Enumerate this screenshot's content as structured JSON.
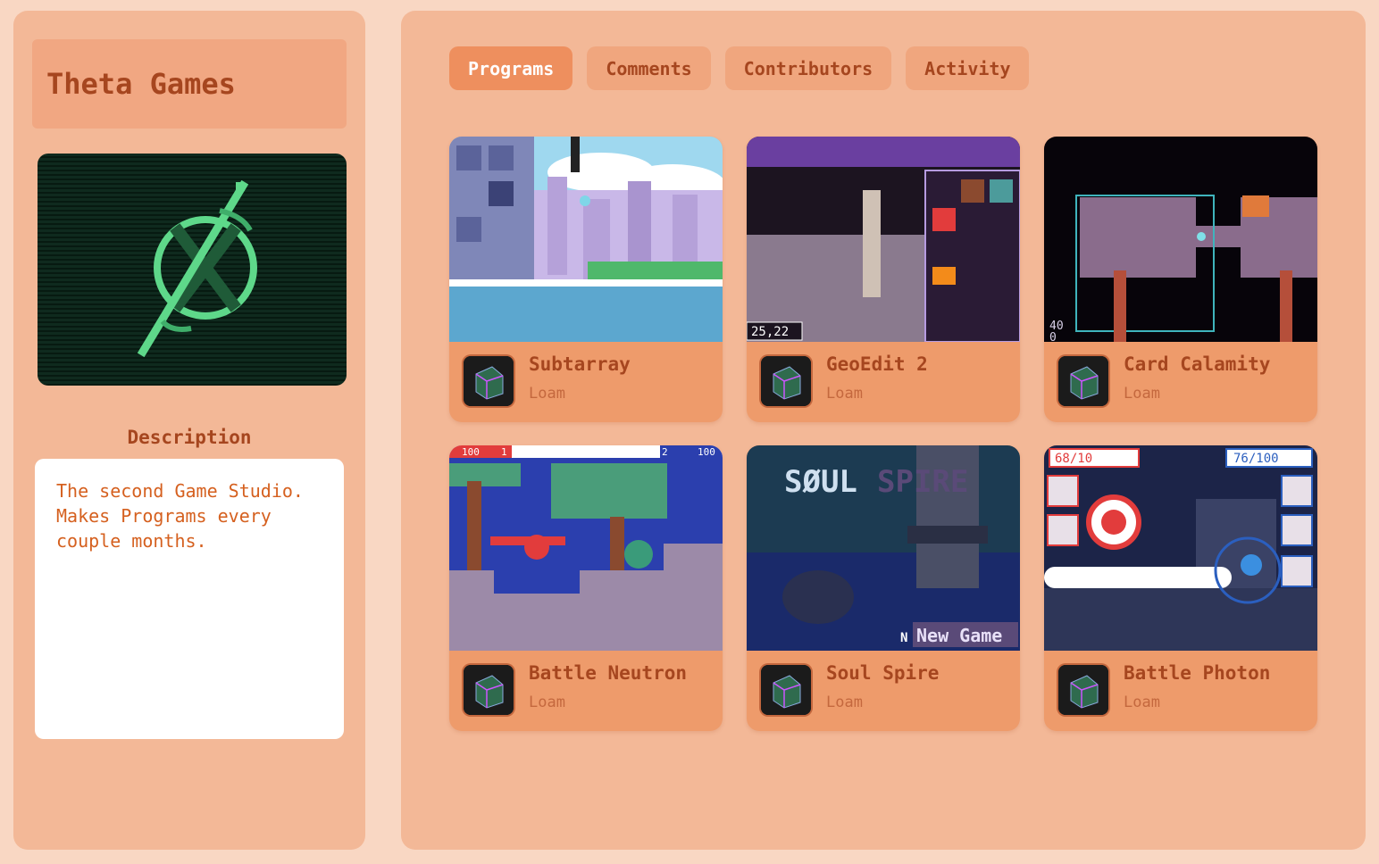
{
  "sidebar": {
    "studio_name": "Theta Games",
    "logo_icon": "theta-x-logo",
    "description_label": "Description",
    "description_text": "The second Game Studio. Makes Programs every couple months."
  },
  "tabs": [
    {
      "label": "Programs",
      "active": true
    },
    {
      "label": "Comments",
      "active": false
    },
    {
      "label": "Contributors",
      "active": false
    },
    {
      "label": "Activity",
      "active": false
    }
  ],
  "programs": [
    {
      "title": "Subtarray",
      "author": "Loam",
      "thumb_text": []
    },
    {
      "title": "GeoEdit 2",
      "author": "Loam",
      "thumb_text": [
        "25,22"
      ]
    },
    {
      "title": "Card Calamity",
      "author": "Loam",
      "thumb_text": [
        "40",
        "0"
      ]
    },
    {
      "title": "Battle Neutron",
      "author": "Loam",
      "thumb_text": [
        "100",
        "1",
        "2",
        "100"
      ]
    },
    {
      "title": "Soul Spire",
      "author": "Loam",
      "thumb_text": [
        "SØUL",
        "SPIRE",
        "N",
        "New Game"
      ]
    },
    {
      "title": "Battle Photon",
      "author": "Loam",
      "thumb_text": [
        "68/10",
        "76/100"
      ]
    }
  ],
  "colors": {
    "page_bg": "#f9d7c3",
    "panel_bg": "#f3b897",
    "accent": "#ee8f5e",
    "title_text": "#a6461f",
    "description_text": "#d5601f"
  }
}
